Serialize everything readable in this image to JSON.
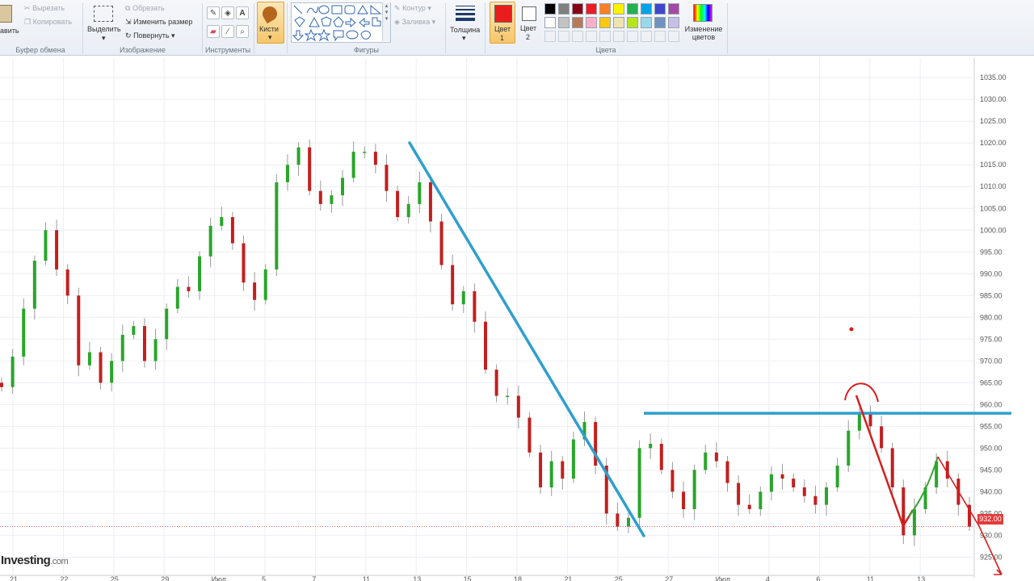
{
  "ribbon": {
    "clipboard": {
      "paste_label": "авить",
      "cut_label": "Вырезать",
      "copy_label": "Копировать",
      "group_label": "Буфер обмена"
    },
    "image": {
      "select_label": "Выделить",
      "crop_label": "Обрезать",
      "resize_label": "Изменить размер",
      "rotate_label": "Повернуть",
      "group_label": "Изображение"
    },
    "tools": {
      "group_label": "Инструменты"
    },
    "brushes": {
      "label": "Кисти"
    },
    "shapes": {
      "outline_label": "Контур",
      "fill_label": "Заливка",
      "group_label": "Фигуры"
    },
    "thickness": {
      "label": "Толщина"
    },
    "colors": {
      "color1_label": "Цвет",
      "color1_num": "1",
      "color2_label": "Цвет",
      "color2_num": "2",
      "edit_label": "Изменение цветов",
      "group_label": "Цвета",
      "color1_value": "#e81e1e",
      "color2_value": "#ffffff",
      "palette_row1": [
        "#000000",
        "#7f7f7f",
        "#880015",
        "#ed1c24",
        "#ff7f27",
        "#fff200",
        "#22b14c",
        "#00a2e8",
        "#3f48cc",
        "#a349a4"
      ],
      "palette_row2": [
        "#ffffff",
        "#c3c3c3",
        "#b97a57",
        "#ffaec9",
        "#ffc90e",
        "#efe4b0",
        "#b5e61d",
        "#99d9ea",
        "#7092be",
        "#c8bfe7"
      ]
    }
  },
  "chart_data": {
    "type": "candlestick",
    "title": "",
    "ylim": [
      921,
      1038
    ],
    "y_ticks": [
      "1035.00",
      "1030.00",
      "1025.00",
      "1020.00",
      "1015.00",
      "1010.00",
      "1005.00",
      "1000.00",
      "995.00",
      "990.00",
      "985.00",
      "980.00",
      "975.00",
      "970.00",
      "965.00",
      "960.00",
      "955.00",
      "950.00",
      "945.00",
      "940.00",
      "935.00",
      "930.00",
      "925.00",
      "920.00"
    ],
    "x_ticks": [
      "21",
      "22",
      "25",
      "29",
      "Июл",
      "5",
      "7",
      "11",
      "13",
      "15",
      "18",
      "21",
      "25",
      "27",
      "Июл",
      "4",
      "6",
      "11",
      "13"
    ],
    "current_price_label": "932.00",
    "current_price": 932,
    "grid": true,
    "closes": [
      964,
      971,
      982,
      993,
      1000,
      991,
      985,
      969,
      972,
      965,
      970,
      976,
      978,
      970,
      975,
      982,
      987,
      986,
      994,
      1001,
      1003,
      997,
      988,
      984,
      991,
      1011,
      1015,
      1019,
      1009,
      1006,
      1008,
      1012,
      1018,
      1018,
      1015,
      1009,
      1003,
      1006,
      1011,
      1002,
      992,
      983,
      986,
      979,
      968,
      962,
      962,
      957,
      949,
      941,
      947,
      943,
      952,
      956,
      946,
      935,
      932,
      934,
      950,
      951,
      945,
      940,
      936,
      945,
      949,
      947,
      942,
      937,
      936,
      940,
      944,
      943,
      941,
      939,
      937,
      941,
      946,
      954,
      958,
      955,
      950,
      941,
      930,
      936,
      941,
      947,
      943,
      937,
      932
    ],
    "annotations": {
      "trendline_color": "#2f9fcd",
      "resistance_value": 958,
      "drawing_color": "#d61e1e"
    }
  },
  "watermark": {
    "brand": "Investing",
    "suffix": ".com"
  }
}
